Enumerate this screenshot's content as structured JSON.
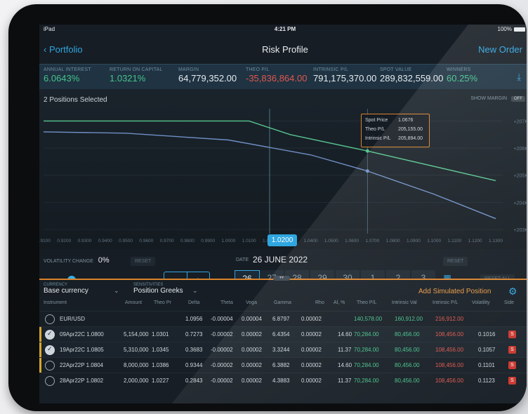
{
  "status_bar": {
    "device": "iPad",
    "time": "4:21 PM",
    "battery": "100%"
  },
  "nav": {
    "back_label": "Portfolio",
    "title": "Risk Profile",
    "action_label": "New Order"
  },
  "metrics": [
    {
      "label": "ANNUAL INTEREST",
      "value": "6.0643%"
    },
    {
      "label": "RETURN ON CAPITAL",
      "value": "1.0321%"
    },
    {
      "label": "MARGIN",
      "value": "64,779,352.00"
    },
    {
      "label": "THEO P/L",
      "value": "-35,836,864.00"
    },
    {
      "label": "INTRINSIC P/L",
      "value": "791,175,370.00"
    },
    {
      "label": "SPOT VALUE",
      "value": "289,832,559.00"
    },
    {
      "label": "WINNERS",
      "value": "60.25%"
    }
  ],
  "chart": {
    "selected_label": "2 Positions Selected",
    "show_margin_label": "SHOW MARGIN",
    "toggle_label": "OFF",
    "selected_spot": "1.0200",
    "tooltip": {
      "rows": [
        {
          "label": "Spot Price",
          "value": "1.0676"
        },
        {
          "label": "Theo P/L",
          "value": "205,155.00"
        },
        {
          "label": "Intrinsic P/L",
          "value": "205,894.00"
        }
      ]
    }
  },
  "chart_data": {
    "type": "line",
    "xlabel": "",
    "ylabel": "",
    "x_ticks": [
      "0.9100",
      "0.9200",
      "0.9300",
      "0.9400",
      "0.9500",
      "0.9600",
      "0.9700",
      "0.9800",
      "0.9900",
      "1.0000",
      "1.0100",
      "1.0200",
      "1.0300",
      "1.0400",
      "1.0500",
      "1.0600",
      "1.0700",
      "1.0800",
      "1.0900",
      "1.1000",
      "1.1100",
      "1.1200",
      "1.1300"
    ],
    "y_ticks": [
      "+207K",
      "+206K",
      "+205K",
      "+204K",
      "+203K"
    ],
    "series": [
      {
        "color": "#57c48e",
        "x": [
          0.91,
          1.01,
          1.03,
          1.0676,
          1.13
        ],
        "y": [
          207000,
          207000,
          206500,
          205894,
          204800
        ]
      },
      {
        "color": "#6f8fc5",
        "x": [
          0.91,
          0.95,
          1.0,
          1.04,
          1.0676,
          1.1,
          1.13
        ],
        "y": [
          206600,
          206550,
          206300,
          205750,
          205155,
          204300,
          203400
        ]
      }
    ]
  },
  "controls": {
    "volatility_label": "VOLATILITY CHANGE",
    "volatility_value": "0%",
    "reset_label": "RESET",
    "volatility_slider_value": 0.5,
    "minus": "−",
    "plus": "+",
    "date_label": "DATE",
    "date_value": "26 JUNE 2022",
    "days": [
      "26",
      "27",
      "28",
      "29",
      "30",
      "1",
      "2",
      "3"
    ],
    "reset_all_label": "RESET ALL"
  },
  "table": {
    "currency_label": "CURRENCY",
    "currency_value": "Base currency",
    "sensitivities_label": "SENSITIVITIES",
    "sensitivities_value": "Position Greeks",
    "add_simulated": "Add Simulated Position",
    "headers": [
      "Instrument",
      "Amount",
      "Theo Pr",
      "Delta",
      "Theta",
      "Vega",
      "Gamma",
      "Rho",
      "Al, %",
      "Theo P/L",
      "Intrinsic Val",
      "Intrinsic P/L",
      "Volatility",
      "Side"
    ],
    "rows": [
      {
        "selected": false,
        "marked": false,
        "instrument": "EUR/USD",
        "amount": "",
        "theo_pr": "",
        "delta": "1.0956",
        "theta": "-0.00004",
        "vega": "0.00004",
        "gamma": "6.8797",
        "rho": "0.00002",
        "ai": "",
        "theo_pl": "140,578.00",
        "intrinsic_val": "160,912.00",
        "intrinsic_pl": "216,912.00",
        "volatility": "",
        "side": ""
      },
      {
        "selected": true,
        "marked": true,
        "instrument": "09Apr22C 1.0800",
        "amount": "5,154,000",
        "theo_pr": "1.0301",
        "delta": "0.7273",
        "theta": "-0.00002",
        "vega": "0.00002",
        "gamma": "6.4354",
        "rho": "0.00002",
        "ai": "14.60",
        "theo_pl": "70,284.00",
        "intrinsic_val": "80,456.00",
        "intrinsic_pl": "108,456.00",
        "volatility": "0.1016",
        "side": "S"
      },
      {
        "selected": true,
        "marked": true,
        "instrument": "19Apr22C 1.0805",
        "amount": "5,310,000",
        "theo_pr": "1.0345",
        "delta": "0.3683",
        "theta": "-0.00002",
        "vega": "0.00002",
        "gamma": "3.3244",
        "rho": "0.00002",
        "ai": "11.37",
        "theo_pl": "70,284.00",
        "intrinsic_val": "80,456.00",
        "intrinsic_pl": "108,456.00",
        "volatility": "0.1057",
        "side": "S"
      },
      {
        "selected": false,
        "marked": true,
        "instrument": "22Apr22P 1.0804",
        "amount": "8,000,000",
        "theo_pr": "1.0386",
        "delta": "0.9344",
        "theta": "-0.00002",
        "vega": "0.00002",
        "gamma": "6.3882",
        "rho": "0.00002",
        "ai": "14.60",
        "theo_pl": "70,284.00",
        "intrinsic_val": "80,456.00",
        "intrinsic_pl": "108,456.00",
        "volatility": "0.1101",
        "side": "S"
      },
      {
        "selected": false,
        "marked": false,
        "instrument": "28Apr22P 1.0802",
        "amount": "2,000,000",
        "theo_pr": "1.0227",
        "delta": "0.2843",
        "theta": "-0.00002",
        "vega": "0.00002",
        "gamma": "4.3883",
        "rho": "0.00002",
        "ai": "11.37",
        "theo_pl": "70,284.00",
        "intrinsic_val": "80,456.00",
        "intrinsic_pl": "108,456.00",
        "volatility": "0.1123",
        "side": "S"
      }
    ]
  },
  "colors": {
    "accent": "#2fa6e0",
    "positive": "#46c28b",
    "negative": "#e0574e",
    "highlight": "#d9822b"
  }
}
